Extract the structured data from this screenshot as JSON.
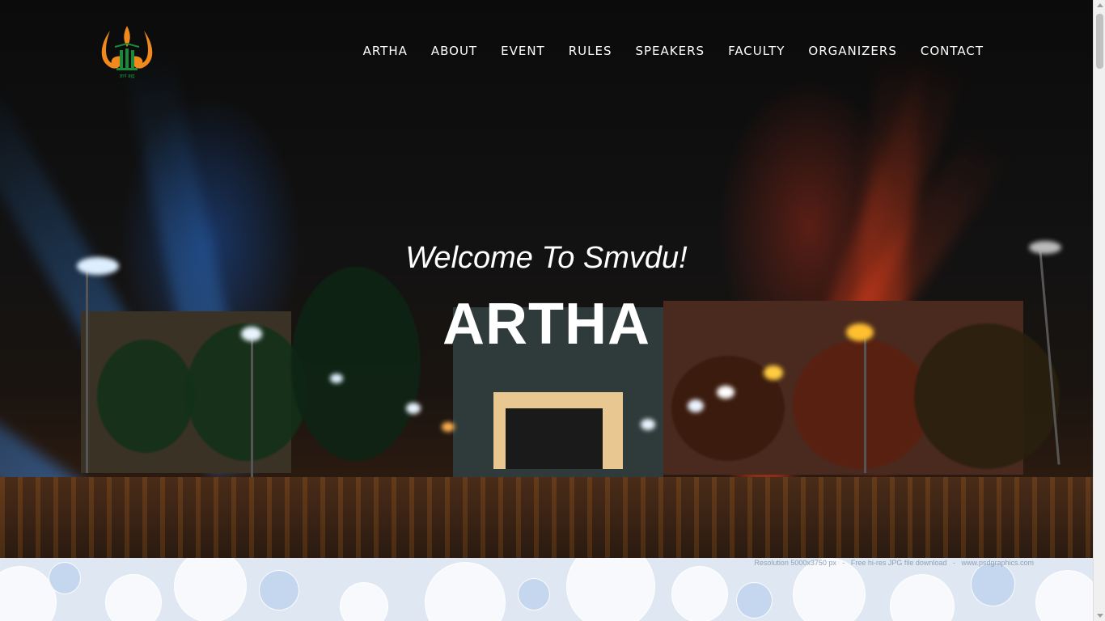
{
  "logo": {
    "icon": "flame-pillars-logo",
    "caption": "ज्ञानं ब्रह्म"
  },
  "nav": {
    "items": [
      "ARTHA",
      "ABOUT",
      "EVENT",
      "RULES",
      "SPEAKERS",
      "FACULTY",
      "ORGANIZERS",
      "CONTACT"
    ]
  },
  "hero": {
    "welcome": "Welcome To Smvdu!",
    "title": "ARTHA"
  },
  "footer_banner": {
    "credit": "Resolution 5000x3750 px   -   Free hi-res JPG file download   -   www.psdgraphics.com"
  },
  "colors": {
    "accent_orange": "#f08a1c",
    "logo_green": "#1a8a3a",
    "nav_text": "#ffffff"
  }
}
